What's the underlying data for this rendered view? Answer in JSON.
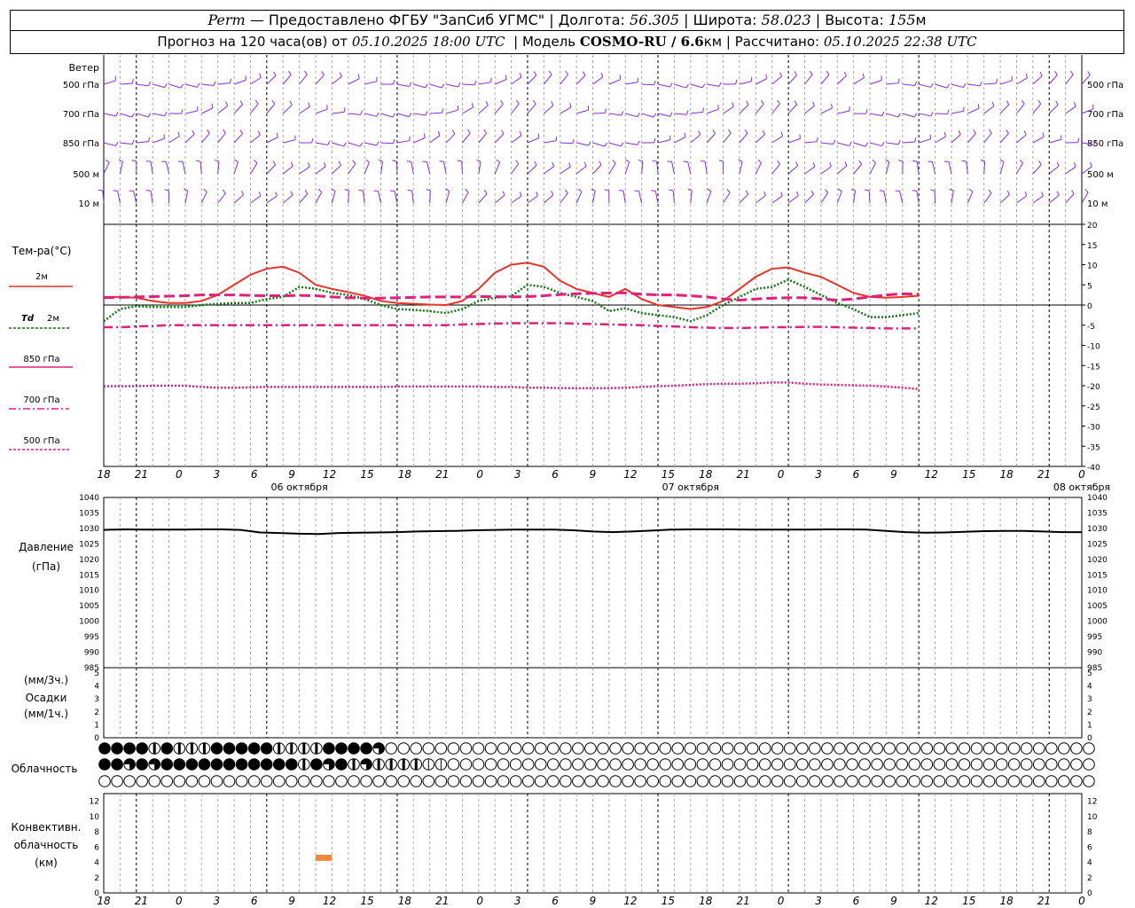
{
  "header": {
    "station": "Perm",
    "dash": "—",
    "provider": "Предоставлено ФГБУ \"ЗапСиб УГМС\"",
    "lon_label": "Долгота:",
    "lon": "56.305",
    "lat_label": "Широта:",
    "lat": "58.023",
    "alt_label": "Высота:",
    "alt": "155",
    "alt_unit": "м",
    "forecast_label": "Прогноз на 120 часа(ов) от",
    "start": "05.10.2025 18:00 UTC",
    "model_label": "Модель",
    "model": "COSMO-RU / 6.6",
    "model_unit": "км",
    "computed_label": "Рассчитано:",
    "computed": "05.10.2025 22:38 UTC"
  },
  "wind_panel": {
    "title": "Ветер",
    "levels": [
      "500 гПа",
      "700 гПа",
      "850 гПа",
      "500 м",
      "10 м"
    ],
    "color": "#8a2be2"
  },
  "time_axis": {
    "hour_labels": [
      "18",
      "21",
      "0",
      "3",
      "6",
      "9",
      "12",
      "15",
      "18",
      "21",
      "0",
      "3",
      "6",
      "9",
      "12",
      "15",
      "18",
      "21",
      "0",
      "3",
      "6",
      "9",
      "12",
      "15",
      "18",
      "21",
      "0"
    ],
    "days": [
      "06 октября",
      "07 октября",
      "08 октября"
    ]
  },
  "chart_data": [
    {
      "type": "line",
      "panel": "temperature",
      "ylabel": "Тем-ра(°C)",
      "ylim": [
        -40,
        20
      ],
      "yticks": [
        20,
        15,
        10,
        5,
        0,
        -5,
        -10,
        -15,
        -20,
        -25,
        -30,
        -35,
        -40
      ],
      "x_hours": [
        0,
        3,
        6,
        9,
        12,
        15,
        18,
        21,
        24,
        27,
        30,
        33,
        36,
        39,
        42,
        45,
        48,
        51,
        54,
        57,
        60,
        63,
        66,
        69,
        72,
        75,
        78,
        81,
        84,
        87,
        90,
        93,
        96,
        99,
        102,
        105,
        108,
        111,
        114,
        117,
        120,
        123,
        126,
        129,
        132,
        135,
        138,
        141,
        144,
        147,
        150,
        153,
        156,
        159,
        162,
        165,
        168,
        171,
        174,
        177,
        180
      ],
      "series": [
        {
          "name": "2м",
          "color": "#e8322a",
          "style": "solid",
          "values": [
            2,
            2,
            1.8,
            1,
            0.5,
            0.5,
            1,
            2.5,
            5,
            7.5,
            9,
            9.5,
            8,
            5,
            4,
            3.2,
            2.3,
            1,
            0.5,
            0.3,
            0.1,
            0,
            1,
            4,
            8,
            10,
            10.5,
            9.5,
            6,
            4,
            3,
            2,
            4,
            1.5,
            0,
            -0.5,
            -1,
            -0.5,
            1,
            4,
            7,
            9,
            9.3,
            8,
            7,
            5,
            3,
            2,
            1.8,
            2,
            2.3
          ]
        },
        {
          "name": "Td 2м",
          "color": "#117a11",
          "style": "dotted",
          "values": [
            -4,
            -1,
            -0.3,
            -0.5,
            -0.5,
            -0.5,
            0,
            0.3,
            0.5,
            0.5,
            1.5,
            2,
            4.5,
            4,
            3,
            2.5,
            1.5,
            0,
            -1,
            -1.2,
            -1.5,
            -2,
            -1,
            1,
            1.8,
            2.2,
            5,
            4.5,
            3,
            2,
            1,
            -1.5,
            -0.8,
            -2,
            -2.5,
            -3,
            -4,
            -2.5,
            0,
            2,
            4,
            4.5,
            6.3,
            4.5,
            2.5,
            0.5,
            -1,
            -3,
            -3,
            -2.5,
            -2
          ]
        },
        {
          "name": "850 гПа",
          "color": "#e0207a",
          "style": "dashed",
          "values": [
            1.8,
            1.9,
            2,
            2.1,
            2.2,
            2.3,
            2.5,
            2.5,
            2.5,
            2.4,
            2.3,
            2.3,
            2.4,
            2.3,
            2,
            1.8,
            1.7,
            1.7,
            1.8,
            1.9,
            2,
            2,
            2,
            2.1,
            2.1,
            2,
            2.1,
            2.3,
            2.6,
            2.8,
            2.9,
            3,
            3,
            2.7,
            2.5,
            2.5,
            2.3,
            2,
            1.5,
            1.2,
            1.5,
            1.7,
            1.8,
            1.8,
            1.5,
            1.2,
            1.5,
            2,
            2.5,
            2.8,
            2.7
          ]
        },
        {
          "name": "700 гПа",
          "color": "#e0207a",
          "style": "dashdot",
          "values": [
            -5.5,
            -5.5,
            -5.3,
            -5.2,
            -5,
            -5,
            -5,
            -5,
            -5,
            -5,
            -5,
            -5,
            -5,
            -5,
            -5,
            -5,
            -5,
            -5,
            -5,
            -5,
            -5,
            -5,
            -4.8,
            -4.7,
            -4.6,
            -4.5,
            -4.5,
            -4.5,
            -4.5,
            -4.6,
            -4.7,
            -4.8,
            -4.9,
            -5,
            -5.2,
            -5.3,
            -5.5,
            -5.6,
            -5.7,
            -5.7,
            -5.6,
            -5.5,
            -5.5,
            -5.4,
            -5.4,
            -5.5,
            -5.6,
            -5.7,
            -5.8,
            -5.8,
            -5.8
          ]
        },
        {
          "name": "500 гПа",
          "color": "#e0207a",
          "style": "dotted",
          "values": [
            -20.1,
            -20.1,
            -20.1,
            -20,
            -20,
            -20,
            -20.3,
            -20.5,
            -20.5,
            -20.4,
            -20.3,
            -20.3,
            -20.3,
            -20.3,
            -20.3,
            -20.3,
            -20.3,
            -20.3,
            -20.2,
            -20.2,
            -20.2,
            -20.2,
            -20.2,
            -20.2,
            -20.3,
            -20.3,
            -20.5,
            -20.5,
            -20.6,
            -20.6,
            -20.6,
            -20.6,
            -20.5,
            -20.3,
            -20.1,
            -20,
            -19.8,
            -19.6,
            -19.5,
            -19.5,
            -19.4,
            -19.2,
            -19.2,
            -19.5,
            -19.7,
            -19.8,
            -19.9,
            -20,
            -20.2,
            -20.5,
            -20.8
          ]
        }
      ]
    },
    {
      "type": "line",
      "panel": "pressure",
      "ylabel": "Давление",
      "ylabel2": "(гПа)",
      "ylim": [
        985,
        1040
      ],
      "yticks": [
        1040,
        1035,
        1030,
        1025,
        1020,
        1015,
        1010,
        1005,
        1000,
        995,
        990,
        985
      ],
      "series": [
        {
          "name": "pressure",
          "color": "#000000",
          "style": "solid",
          "values": [
            1029.5,
            1029.7,
            1029.6,
            1029.6,
            1029.6,
            1029.7,
            1029.7,
            1029.5,
            1028.7,
            1028.5,
            1028.3,
            1028.2,
            1028.5,
            1028.6,
            1028.7,
            1028.8,
            1029,
            1029.1,
            1029.2,
            1029.4,
            1029.5,
            1029.6,
            1029.6,
            1029.6,
            1029.4,
            1029,
            1028.8,
            1029,
            1029.3,
            1029.6,
            1029.7,
            1029.7,
            1029.7,
            1029.6,
            1029.6,
            1029.6,
            1029.6,
            1029.7,
            1029.7,
            1029.6,
            1029.2,
            1028.8,
            1028.6,
            1028.7,
            1028.9,
            1029.1,
            1029.2,
            1029.2,
            1029,
            1028.8,
            1028.8
          ]
        }
      ]
    },
    {
      "type": "bar",
      "panel": "precipitation",
      "ylabel": "(мм/3ч.)",
      "ylabel2": "Осадки",
      "ylabel3": "(мм/1ч.)",
      "ylim": [
        0,
        5
      ],
      "yticks": [
        5,
        4,
        3,
        2,
        1,
        0
      ],
      "values": []
    },
    {
      "type": "table",
      "panel": "cloudiness",
      "ylabel": "Облачность",
      "rows": [
        [
          8,
          8,
          8,
          8,
          4,
          8,
          4,
          4,
          4,
          8,
          8,
          8,
          8,
          8,
          4,
          4,
          4,
          4,
          8,
          8,
          8,
          8,
          6,
          0,
          0,
          0,
          0,
          0,
          0,
          0,
          0,
          0,
          0,
          0,
          0,
          0,
          0,
          0,
          0,
          0,
          0,
          0,
          0,
          0,
          0,
          0,
          0,
          0,
          0,
          0,
          0,
          0,
          0,
          0,
          0,
          0,
          0,
          0,
          0,
          0,
          0,
          0,
          0,
          0,
          0,
          0,
          0,
          0,
          0,
          0,
          0,
          0,
          0,
          0,
          0,
          0,
          0,
          0,
          0,
          0,
          0
        ],
        [
          8,
          8,
          6,
          8,
          6,
          8,
          8,
          8,
          8,
          8,
          8,
          8,
          8,
          8,
          8,
          8,
          4,
          8,
          6,
          8,
          5,
          6,
          5,
          4,
          4,
          4,
          3,
          3,
          0,
          0,
          0,
          0,
          0,
          0,
          0,
          0,
          0,
          0,
          0,
          0,
          0,
          0,
          0,
          0,
          0,
          0,
          0,
          0,
          0,
          0,
          0,
          0,
          0,
          0,
          0,
          0,
          0,
          0,
          0,
          0,
          0,
          0,
          0,
          0,
          0,
          0,
          0,
          0,
          0,
          0,
          0,
          0,
          0,
          0,
          0,
          0,
          0,
          0,
          0,
          0,
          0
        ],
        [
          0,
          0,
          0,
          0,
          0,
          0,
          0,
          0,
          0,
          0,
          0,
          0,
          0,
          0,
          0,
          0,
          0,
          0,
          0,
          0,
          0,
          0,
          0,
          0,
          0,
          0,
          0,
          0,
          0,
          0,
          0,
          0,
          0,
          0,
          0,
          0,
          0,
          0,
          0,
          0,
          0,
          0,
          0,
          0,
          0,
          0,
          0,
          0,
          0,
          0,
          0,
          0,
          0,
          0,
          0,
          0,
          0,
          0,
          0,
          0,
          0,
          0,
          0,
          0,
          0,
          0,
          0,
          0,
          0,
          0,
          0,
          0,
          0,
          0,
          0,
          0,
          0,
          0,
          0,
          0,
          0
        ]
      ]
    },
    {
      "type": "bar",
      "panel": "convective",
      "ylabel": "Конвективн.",
      "ylabel2": "облачность",
      "ylabel3": "(км)",
      "ylim": [
        0,
        13
      ],
      "yticks": [
        12,
        10,
        8,
        6,
        4,
        2,
        0
      ],
      "color": "#f0883a",
      "bars": [
        {
          "x_hours": [
            39,
            42
          ],
          "base": 4.2,
          "top": 5.0
        }
      ]
    }
  ],
  "legend": {
    "t2m_label": "2м",
    "td_label": "Td",
    "td_sub": "2м",
    "p850": "850 гПа",
    "p700": "700 гПа",
    "p500": "500 гПа"
  }
}
